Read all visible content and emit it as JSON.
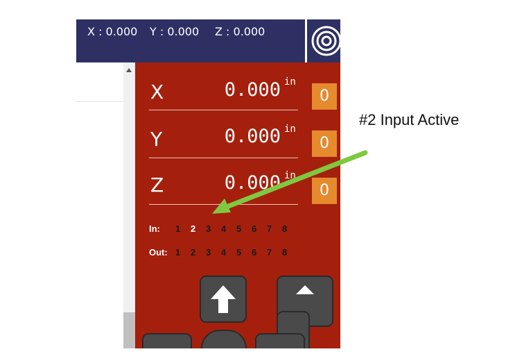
{
  "topbar": {
    "x_readout": "X : 0.000",
    "y_readout": "Y : 0.000",
    "z_readout": "Z : 0.000",
    "logo_icon": "target-rings-icon"
  },
  "dro": {
    "unit": "in",
    "zero_label": "0",
    "axes": [
      {
        "label": "X",
        "value": "0.000"
      },
      {
        "label": "Y",
        "value": "0.000"
      },
      {
        "label": "Z",
        "value": "0.000"
      }
    ]
  },
  "io": {
    "in_label": "In:",
    "out_label": "Out:",
    "inputs": [
      "1",
      "2",
      "3",
      "4",
      "5",
      "6",
      "7",
      "8"
    ],
    "outputs": [
      "1",
      "2",
      "3",
      "4",
      "5",
      "6",
      "7",
      "8"
    ],
    "active_input": "2"
  },
  "jog": {
    "icons": [
      "arrow-up-icon",
      "triangle-up-icon"
    ]
  },
  "annotation": {
    "text": "#2 Input Active",
    "arrow_color": "#80c840"
  },
  "colors": {
    "topbar": "#2e3063",
    "panel": "#a4200d",
    "zero_button": "#e68a2e",
    "jog_button": "#4a4a4a"
  }
}
